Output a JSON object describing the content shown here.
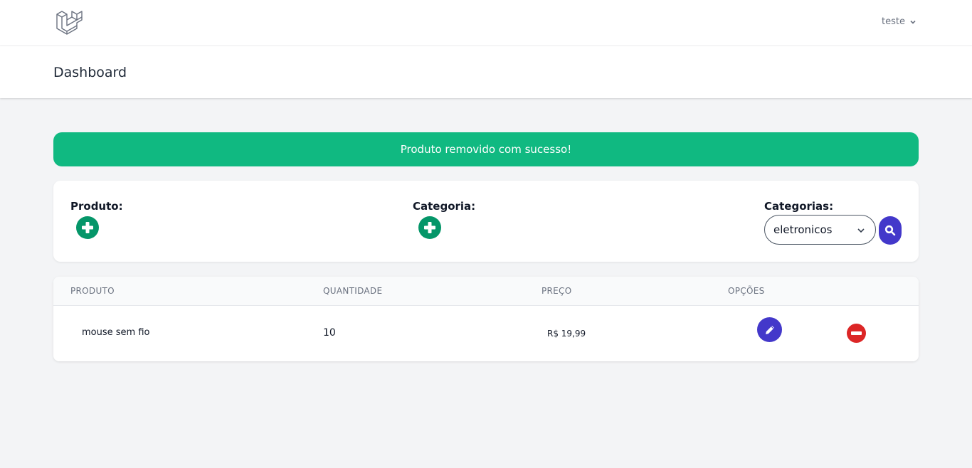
{
  "nav": {
    "logo_icon": "laravel-logo-icon",
    "user_name": "teste",
    "user_chevron_icon": "chevron-down-icon"
  },
  "header": {
    "title": "Dashboard"
  },
  "alert": {
    "message": "Produto removido com sucesso!",
    "color": "#10b981"
  },
  "actions": {
    "produto_label": "Produto:",
    "categoria_label": "Categoria:",
    "add_icon": "plus-circle-icon",
    "filter_label": "Categorias:",
    "selected_category": "eletronicos",
    "search_icon": "search-icon"
  },
  "table": {
    "columns": [
      "Produto",
      "Quantidade",
      "Preço",
      "Opções"
    ],
    "rows": [
      {
        "produto": "mouse sem fio",
        "quantidade": "10",
        "preco": "R$ 19,99"
      }
    ]
  },
  "colors": {
    "accent": "#4338ca",
    "add": "#059669",
    "danger": "#dc2626"
  }
}
